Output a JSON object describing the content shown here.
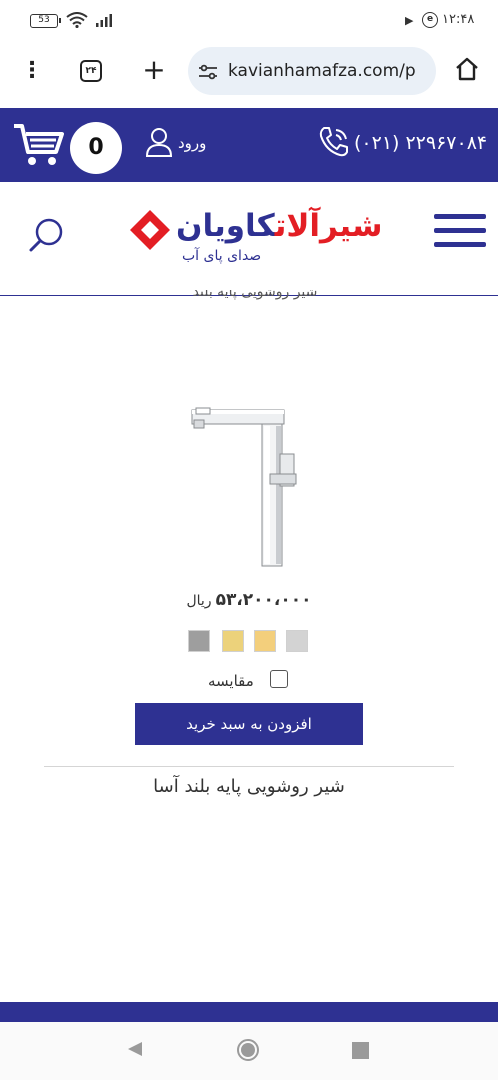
{
  "status_bar": {
    "battery": "53",
    "time": "۱۲:۴۸"
  },
  "browser": {
    "tab_count": "۲۴",
    "url": "kavianhamafza.com/p",
    "icons": [
      "menu-dots-icon",
      "tab-switcher-icon",
      "plus-icon",
      "site-settings-icon",
      "home-icon"
    ]
  },
  "topnav": {
    "cart_count": "0",
    "login_label": "ورود",
    "phone": "(۰۲۱) ۲۲۹۶۷۰۸۴"
  },
  "header": {
    "logo_title_part1": "شیرآلات",
    "logo_title_part2": "کاویان",
    "logo_tagline": "صدای پای آب"
  },
  "product": {
    "cut_text": "شیر روشویی پایه بلند",
    "price_value": "۵۳،۲۰۰،۰۰۰",
    "price_currency": "ریال",
    "swatch_colors": [
      "#9e9e9e",
      "#ecd27b",
      "#f3cf7c",
      "#d3d3d3"
    ],
    "compare_label": "مقایسه",
    "add_to_cart_label": "افزودن به سبد خرید",
    "name": "شیر روشویی پایه بلند آسا"
  },
  "colors": {
    "brand_blue": "#2e3192",
    "brand_red": "#e31e24"
  }
}
